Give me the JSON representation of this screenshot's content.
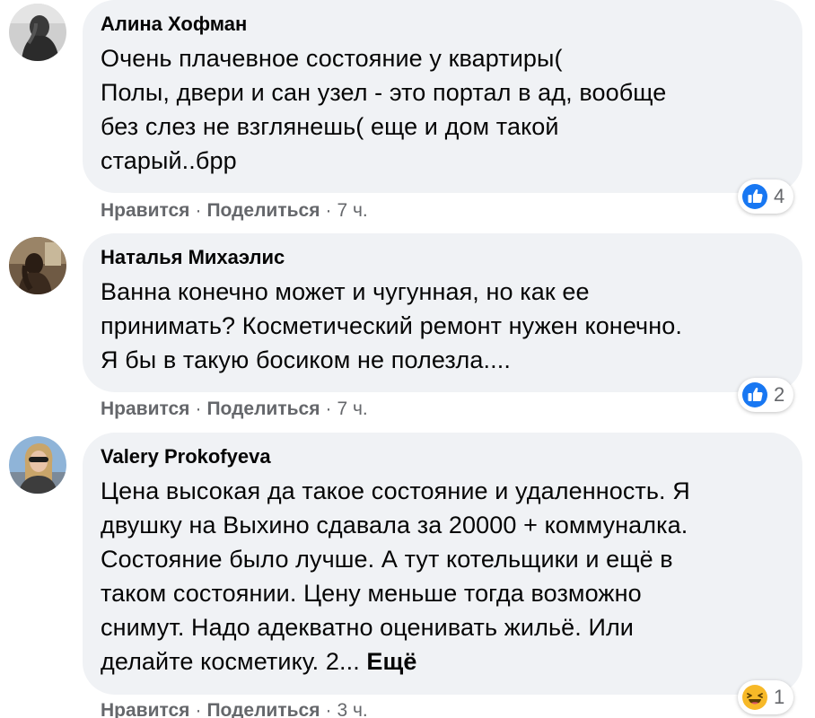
{
  "colors": {
    "bubble_bg": "#f0f2f5",
    "meta_text": "#65676b",
    "like_blue": "#1877f2",
    "haha_yellow": "#f7b928"
  },
  "comments": [
    {
      "author": "Алина Хофман",
      "text": "Очень плачевное состояние у квартиры(\nПолы, двери и сан узел - это портал в ад, вообще без слез не взглянешь( еще и дом такой старый..брр",
      "actions": {
        "like": "Нравится",
        "share": "Поделиться",
        "time": "7 ч."
      },
      "reaction": {
        "icon": "like-icon",
        "count": "4"
      }
    },
    {
      "author": "Наталья Михаэлис",
      "text": "Ванна конечно может и чугунная, но как ее принимать? Косметический ремонт нужен конечно. Я бы в такую босиком не полезла....",
      "actions": {
        "like": "Нравится",
        "share": "Поделиться",
        "time": "7 ч."
      },
      "reaction": {
        "icon": "like-icon",
        "count": "2"
      }
    },
    {
      "author": "Valery Prokofyeva",
      "text": "Цена высокая да такое состояние и удаленность. Я двушку на Выхино сдавала за 20000 + коммуналка. Состояние было лучше. А тут котельщики и ещё в таком состоянии. Цену меньше тогда возможно снимут. Надо адекватно оценивать жильё. Или делайте косметику. 2...",
      "more": "Ещё",
      "actions": {
        "like": "Нравится",
        "share": "Поделиться",
        "time": "3 ч."
      },
      "reaction": {
        "icon": "haha-icon",
        "count": "1"
      }
    }
  ],
  "separator": "·"
}
